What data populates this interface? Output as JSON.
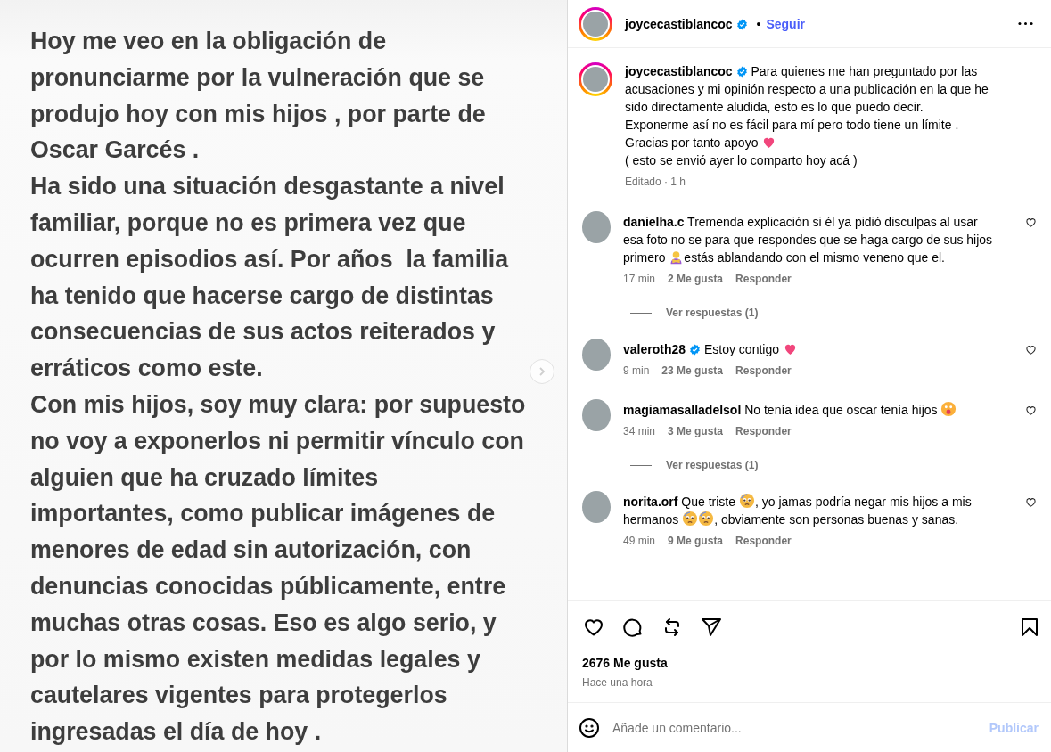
{
  "note_image": {
    "lines": [
      "Hoy me veo en la obligación de",
      "pronunciarme por la vulneración que se",
      "produjo hoy con mis hijos , por parte de",
      "Oscar Garcés .",
      "Ha sido una situación desgastante a nivel",
      "familiar, porque no es primera vez que",
      "ocurren episodios así. Por años  la familia",
      "ha tenido que hacerse cargo de distintas",
      "consecuencias de sus actos reiterados y",
      "erráticos como este.",
      "Con mis hijos, soy muy clara: por supuesto",
      "no voy a exponerlos ni permitir vínculo con",
      "alguien que ha cruzado límites",
      "importantes, como publicar imágenes de",
      "menores de edad sin autorización, con",
      "denuncias conocidas públicamente, entre",
      "muchas otras cosas. Eso es algo serio, y",
      "por lo mismo existen medidas legales y",
      "cautelares vigentes para protegerlos",
      "ingresadas el día de hoy ."
    ]
  },
  "header": {
    "username": "joycecastiblancoc",
    "verified": true,
    "has_story": true,
    "separator": "•",
    "follow": "Seguir"
  },
  "caption": {
    "username": "joycecastiblancoc",
    "verified": true,
    "has_story": true,
    "segments": [
      {
        "kind": "text",
        "text": "Para quienes me han preguntado por las acusaciones y mi opinión respecto a una publicación en la que he sido directamente aludida, esto es lo que puedo decir.\nExponerme así no es fácil para mí pero todo tiene un límite .\nGracias por tanto apoyo "
      },
      {
        "kind": "heart"
      },
      {
        "kind": "text",
        "text": "\n( esto se envió ayer lo comparto hoy acá )"
      }
    ],
    "meta": "Editado · 1 h"
  },
  "comments": [
    {
      "username": "danielha.c",
      "verified": false,
      "segments": [
        {
          "kind": "text",
          "text": "Tremenda explicación si él ya pidió disculpas al usar esa foto no se para que respondes que se haga cargo de sus hijos primero "
        },
        {
          "kind": "person"
        },
        {
          "kind": "text",
          "text": "estás ablandando con el mismo veneno que el."
        }
      ],
      "time": "17 min",
      "likes": "2 Me gusta",
      "reply": "Responder",
      "view_replies": "Ver respuestas (1)"
    },
    {
      "username": "valeroth28",
      "verified": true,
      "segments": [
        {
          "kind": "text",
          "text": "Estoy contigo "
        },
        {
          "kind": "heart"
        }
      ],
      "time": "9 min",
      "likes": "23 Me gusta",
      "reply": "Responder"
    },
    {
      "username": "magiamasalladelsol",
      "verified": false,
      "segments": [
        {
          "kind": "text",
          "text": "No tenía idea que oscar tenía hijos "
        },
        {
          "kind": "surprised-face"
        }
      ],
      "time": "34 min",
      "likes": "3 Me gusta",
      "reply": "Responder",
      "view_replies": "Ver respuestas (1)"
    },
    {
      "username": "norita.orf",
      "verified": false,
      "segments": [
        {
          "kind": "text",
          "text": "Que triste "
        },
        {
          "kind": "pleading-face"
        },
        {
          "kind": "text",
          "text": ", yo jamas podría negar mis hijos a mis hermanos "
        },
        {
          "kind": "pleading-face"
        },
        {
          "kind": "pleading-face"
        },
        {
          "kind": "text",
          "text": ", obviamente son personas buenas y sanas."
        }
      ],
      "time": "49 min",
      "likes": "9 Me gusta",
      "reply": "Responder"
    }
  ],
  "likes": "2676 Me gusta",
  "posted": "Hace una hora",
  "comment_box": {
    "placeholder": "Añade un comentario...",
    "submit": "Publicar",
    "submit_disabled": true
  }
}
